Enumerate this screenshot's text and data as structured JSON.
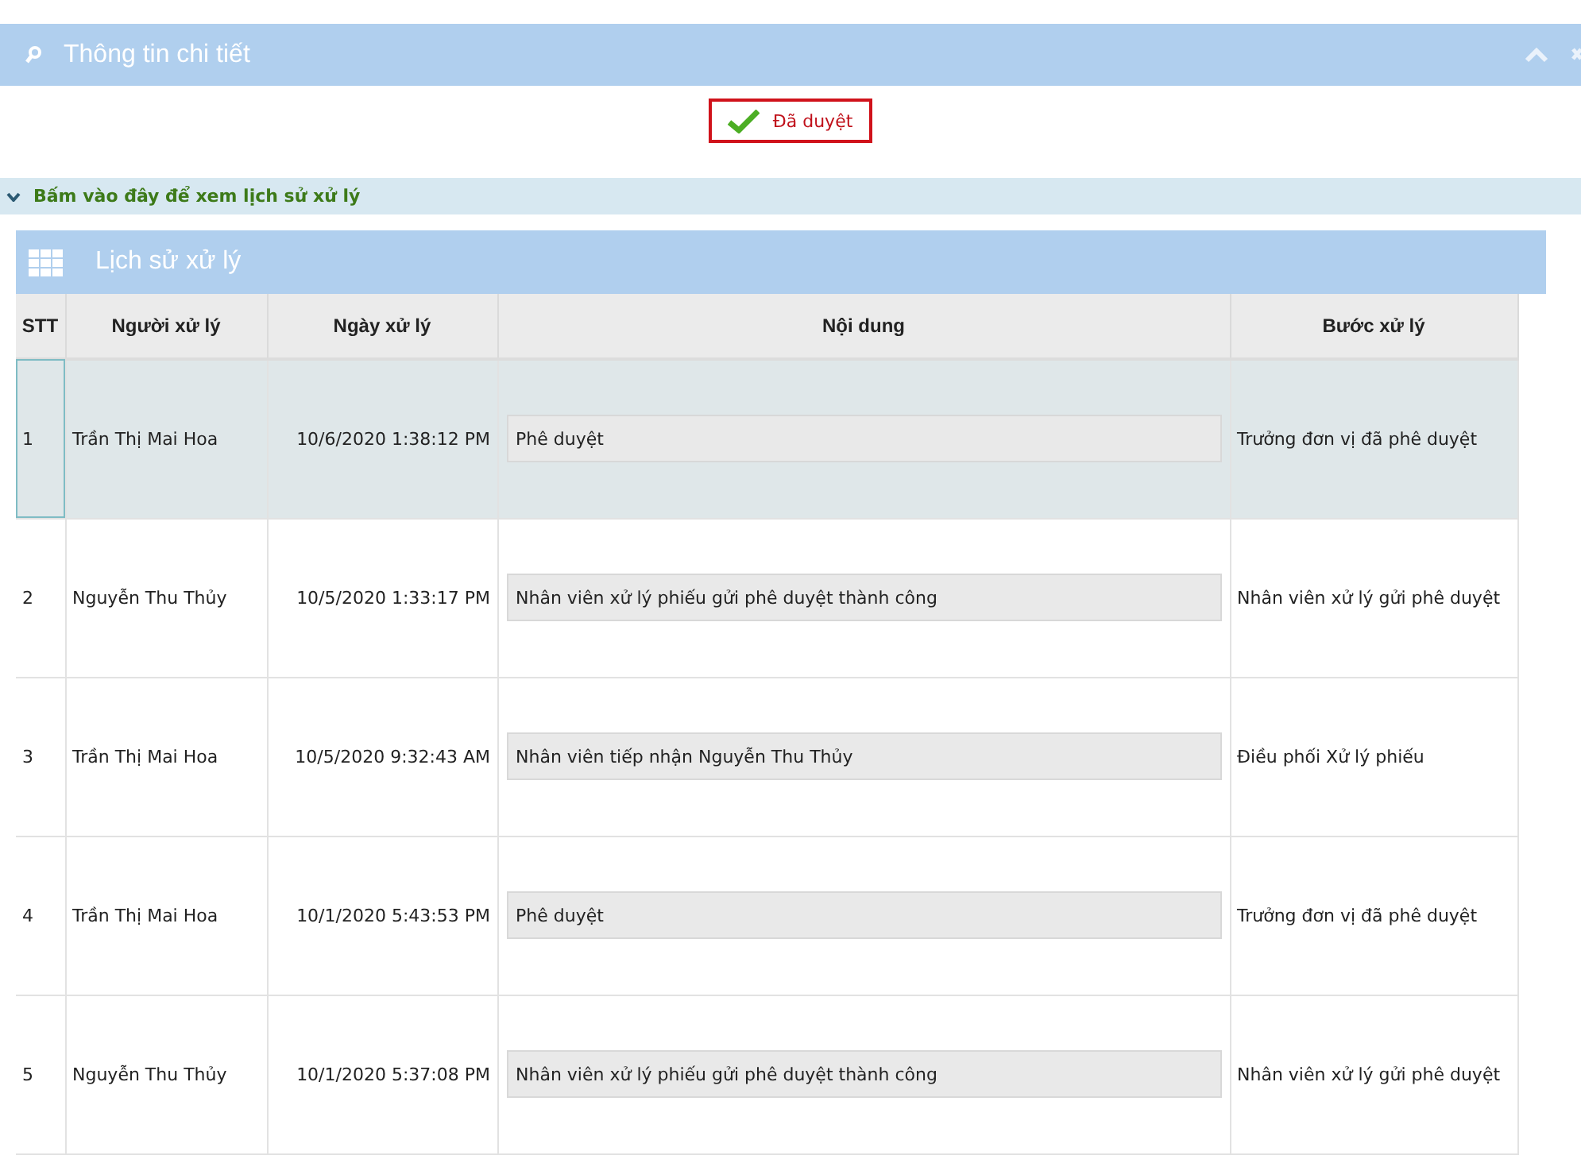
{
  "panel": {
    "title": "Thông tin chi tiết",
    "expanded": true
  },
  "status": {
    "label": "Đã duyệt"
  },
  "history_toggle": {
    "label": "Bấm vào đây để xem lịch sử xử lý",
    "expanded": true
  },
  "history": {
    "title": "Lịch sử xử lý",
    "columns": [
      "STT",
      "Người xử lý",
      "Ngày xử lý",
      "Nội dung",
      "Bước xử lý"
    ],
    "rows": [
      {
        "index": "1",
        "person": "Trần Thị Mai Hoa",
        "date": "10/6/2020 1:38:12 PM",
        "content": "Phê duyệt",
        "step": "Trưởng đơn vị đã phê duyệt",
        "selected": true
      },
      {
        "index": "2",
        "person": "Nguyễn Thu Thủy",
        "date": "10/5/2020 1:33:17 PM",
        "content": "Nhân viên xử lý phiếu gửi phê duyệt thành công",
        "step": "Nhân viên xử lý gửi phê duyệt",
        "selected": false
      },
      {
        "index": "3",
        "person": "Trần Thị Mai Hoa",
        "date": "10/5/2020 9:32:43 AM",
        "content": "Nhân viên tiếp nhận Nguyễn Thu Thủy",
        "step": "Điều phối Xử lý phiếu",
        "selected": false
      },
      {
        "index": "4",
        "person": "Trần Thị Mai Hoa",
        "date": "10/1/2020 5:43:53 PM",
        "content": "Phê duyệt",
        "step": "Trưởng đơn vị đã phê duyệt",
        "selected": false
      },
      {
        "index": "5",
        "person": "Nguyễn Thu Thủy",
        "date": "10/1/2020 5:37:08 PM",
        "content": "Nhân viên xử lý phiếu gửi phê duyệt thành công",
        "step": "Nhân viên xử lý gửi phê duyệt",
        "selected": false
      }
    ]
  }
}
